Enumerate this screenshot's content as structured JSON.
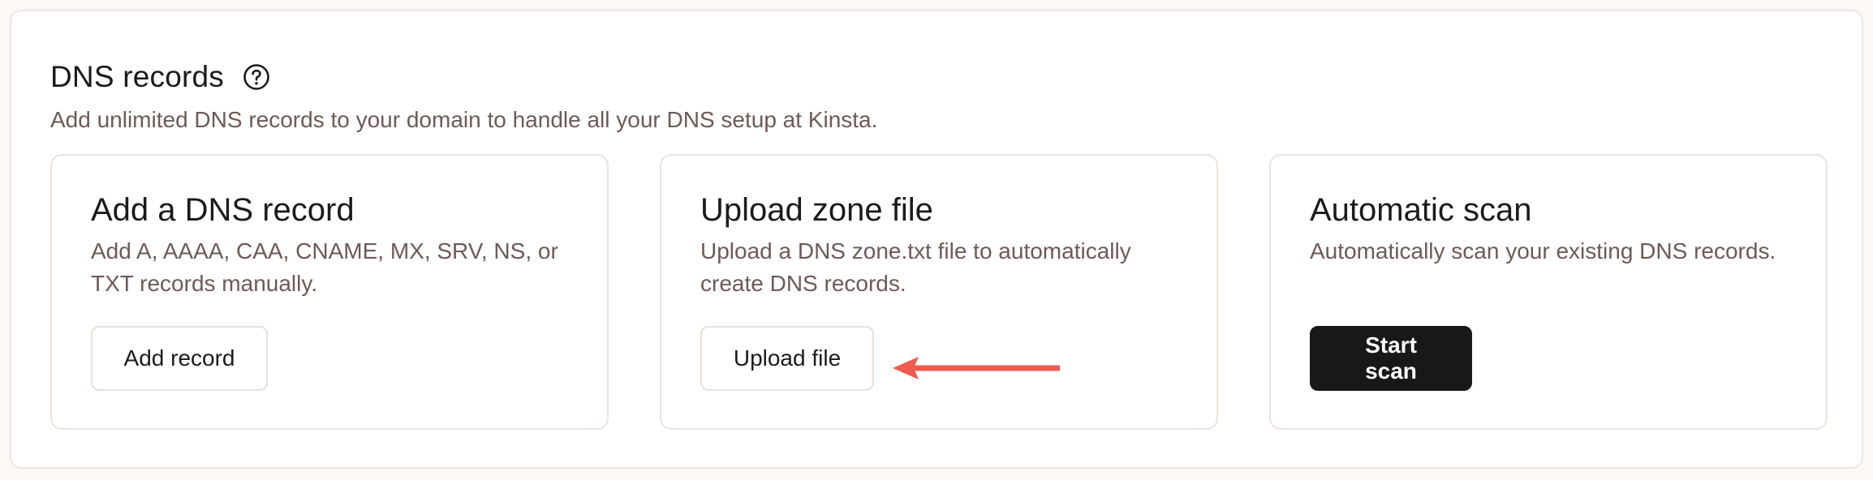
{
  "section": {
    "title": "DNS records",
    "subtitle": "Add unlimited DNS records to your domain to handle all your DNS setup at Kinsta.",
    "help_icon": "question-circle-icon"
  },
  "cards": [
    {
      "title": "Add a DNS record",
      "description": "Add A, AAAA, CAA, CNAME, MX, SRV, NS, or TXT records manually.",
      "button_label": "Add record"
    },
    {
      "title": "Upload zone file",
      "description": "Upload a DNS zone.txt file to automatically create DNS records.",
      "button_label": "Upload file"
    },
    {
      "title": "Automatic scan",
      "description": "Automatically scan your existing DNS records.",
      "button_label": "Start scan"
    }
  ],
  "annotation": {
    "arrow_icon": "red-pointer-arrow-icon",
    "arrow_color": "#f05a4f"
  },
  "colors": {
    "text_primary": "#1b1b1b",
    "text_secondary": "#6e5a57",
    "border": "#ece3dd",
    "primary_button": "#1a1717"
  }
}
